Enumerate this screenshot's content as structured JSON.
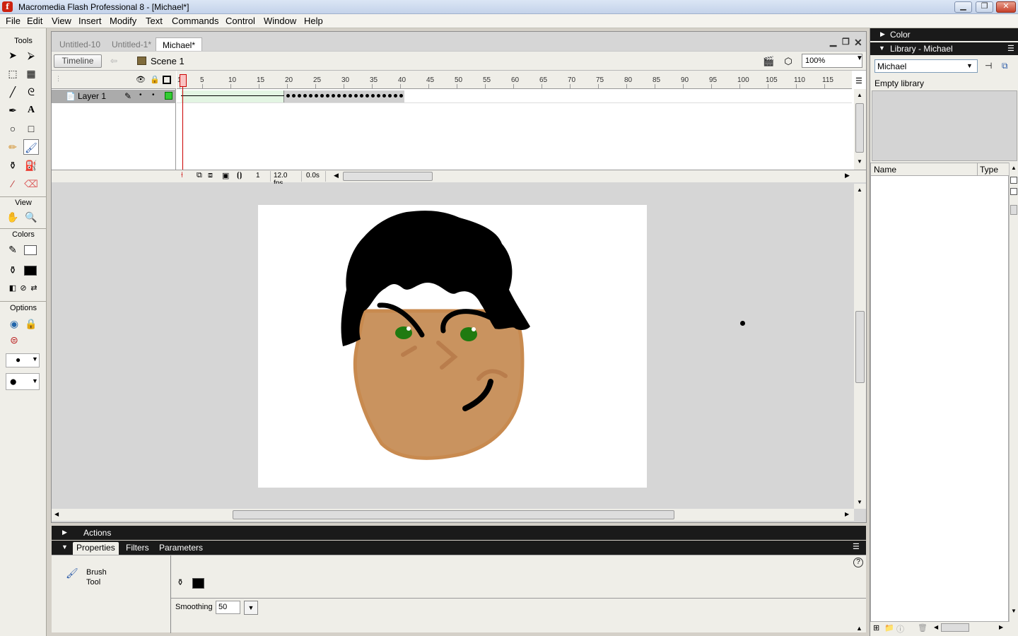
{
  "window": {
    "title": "Macromedia Flash Professional 8 - [Michael*]",
    "app_icon": "f"
  },
  "menu": [
    "File",
    "Edit",
    "View",
    "Insert",
    "Modify",
    "Text",
    "Commands",
    "Control",
    "Window",
    "Help"
  ],
  "tools": {
    "label": "Tools",
    "view_label": "View",
    "colors_label": "Colors",
    "options_label": "Options"
  },
  "document": {
    "tabs": [
      "Untitled-10",
      "Untitled-1*",
      "Michael*"
    ],
    "active_tab": "Michael*",
    "timeline_button": "Timeline",
    "scene": "Scene 1",
    "zoom": "100%"
  },
  "timeline": {
    "layer_name": "Layer 1",
    "ruler_labels": [
      "1",
      "5",
      "10",
      "15",
      "20",
      "25",
      "30",
      "35",
      "40",
      "45",
      "50",
      "55",
      "60",
      "65",
      "70",
      "75",
      "80",
      "85",
      "90",
      "95",
      "100",
      "105",
      "110",
      "115"
    ],
    "current_frame": "1",
    "fps": "12.0 fps",
    "time": "0.0s"
  },
  "panels": {
    "actions": "Actions",
    "properties_tabs": [
      "Properties",
      "Filters",
      "Parameters"
    ],
    "tool_name_1": "Brush",
    "tool_name_2": "Tool",
    "smoothing_label": "Smoothing",
    "smoothing_value": "50"
  },
  "right": {
    "color_panel": "Color",
    "library_panel": "Library - Michael",
    "library_select": "Michael",
    "library_status": "Empty library",
    "col_name": "Name",
    "col_type": "Type"
  },
  "colors": {
    "skin": "#c9935f",
    "skin_outline": "#c88a4f",
    "hair": "#000000",
    "eye": "#1f7a10",
    "stroke_color": "#000000",
    "fill_color": "#000000"
  }
}
